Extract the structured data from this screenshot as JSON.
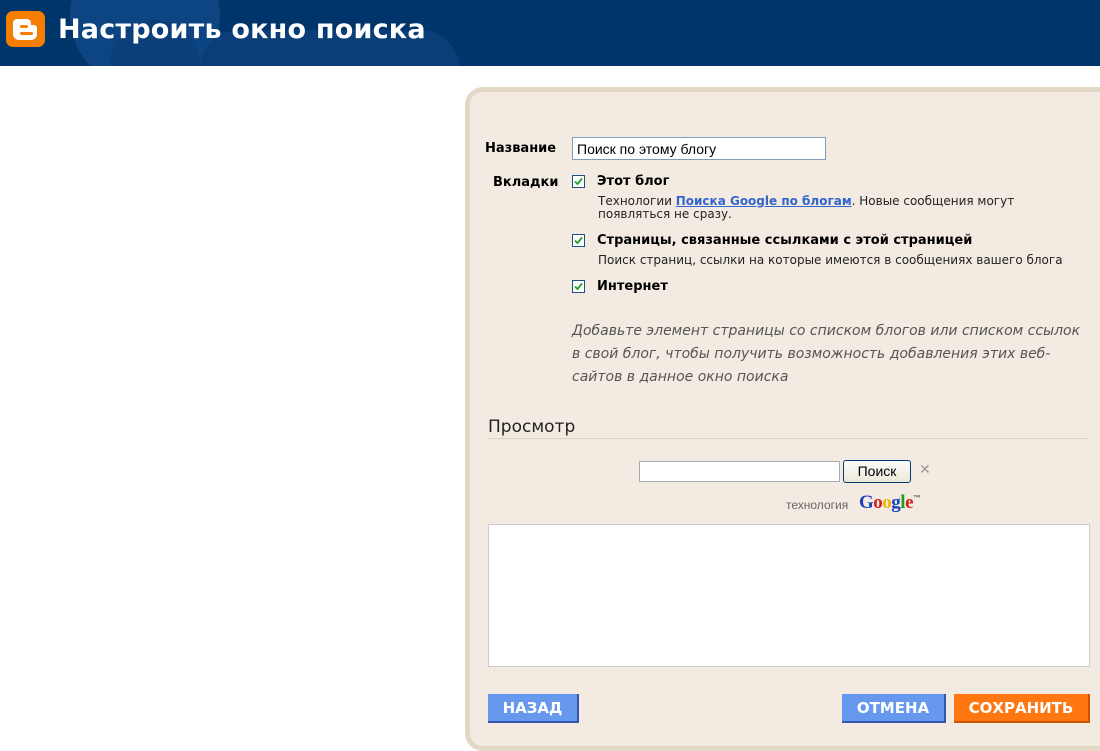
{
  "header": {
    "title": "Настроить окно поиска",
    "logo_icon": "blogger-logo-icon",
    "background_color": "#00356b",
    "logo_color": "#f57d00"
  },
  "form": {
    "title_label": "Название",
    "title_value": "Поиск по этому блогу",
    "tabs_label": "Вкладки",
    "options": [
      {
        "title": "Этот блог",
        "checked": true,
        "desc_prefix": "Технологии ",
        "desc_link": "Поиска Google по блогам",
        "desc_suffix": ". Новые сообщения могут появляться не сразу."
      },
      {
        "title": "Страницы, связанные ссылками с этой страницей",
        "checked": true,
        "desc": "Поиск страниц, ссылки на которые имеются в сообщениях вашего блога"
      },
      {
        "title": "Интернет",
        "checked": true
      }
    ],
    "hint": "Добавьте элемент страницы со списком блогов или списком ссылок в свой блог, чтобы получить возможность добавления этих веб-сайтов в данное окно поиска"
  },
  "preview": {
    "heading": "Просмотр",
    "search_value": "",
    "search_button": "Поиск",
    "clear_icon": "close-icon",
    "powered_by": "технология",
    "google_logo": "Google",
    "google_tm": "™"
  },
  "buttons": {
    "back": "НАЗАД",
    "cancel": "ОТМЕНА",
    "save": "СОХРАНИТЬ"
  }
}
